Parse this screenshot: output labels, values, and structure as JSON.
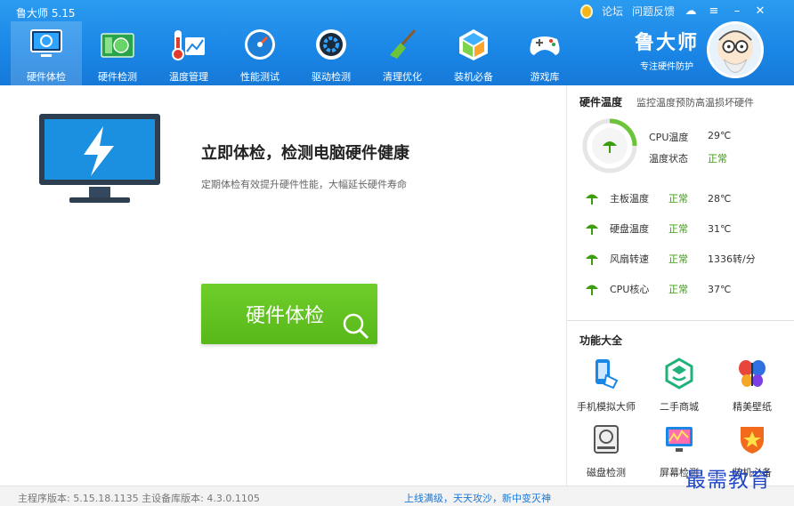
{
  "app": {
    "title": "鲁大师 5.15"
  },
  "top_links": {
    "forum": "论坛",
    "feedback": "问题反馈"
  },
  "nav": [
    {
      "label": "硬件体检",
      "icon": "monitor-check-icon"
    },
    {
      "label": "硬件检测",
      "icon": "circuit-board-icon"
    },
    {
      "label": "温度管理",
      "icon": "thermometer-icon"
    },
    {
      "label": "性能测试",
      "icon": "speedometer-icon"
    },
    {
      "label": "驱动检测",
      "icon": "gear-icon"
    },
    {
      "label": "清理优化",
      "icon": "broom-icon"
    },
    {
      "label": "装机必备",
      "icon": "cube-icon"
    },
    {
      "label": "游戏库",
      "icon": "gamepad-icon"
    }
  ],
  "brand": {
    "name": "鲁大师",
    "slogan": "专注硬件防护"
  },
  "main": {
    "headline": "立即体检，检测电脑硬件健康",
    "subline": "定期体检有效提升硬件性能，大幅延长硬件寿命",
    "check_button": "硬件体检"
  },
  "side": {
    "title": "硬件温度",
    "subtitle": "监控温度预防高温损坏硬件",
    "cpu": {
      "label": "CPU温度",
      "value": "29℃",
      "status_label": "温度状态",
      "status": "正常"
    },
    "temps": [
      {
        "label": "主板温度",
        "status": "正常",
        "value": "28℃"
      },
      {
        "label": "硬盘温度",
        "status": "正常",
        "value": "31℃"
      },
      {
        "label": "风扇转速",
        "status": "正常",
        "value": "1336转/分"
      },
      {
        "label": "CPU核心",
        "status": "正常",
        "value": "37℃"
      }
    ],
    "func_title": "功能大全",
    "tools": [
      {
        "label": "手机模拟大师",
        "icon": "phone-icon"
      },
      {
        "label": "二手商城",
        "icon": "hexagon-smile-icon"
      },
      {
        "label": "精美壁纸",
        "icon": "butterfly-icon"
      },
      {
        "label": "磁盘检测",
        "icon": "disk-icon"
      },
      {
        "label": "屏幕检测",
        "icon": "screen-icon"
      },
      {
        "label": "装机必备",
        "icon": "shield-star-icon"
      }
    ]
  },
  "footer": {
    "version": "主程序版本: 5.15.18.1135  主设备库版本: 4.3.0.1105",
    "promo": "上线满级，天天攻沙，新中变灭神"
  },
  "watermark": "最需教育",
  "colors": {
    "header": "#1a86e6",
    "accent_green": "#58b81a",
    "status_green": "#3c9e0f"
  }
}
